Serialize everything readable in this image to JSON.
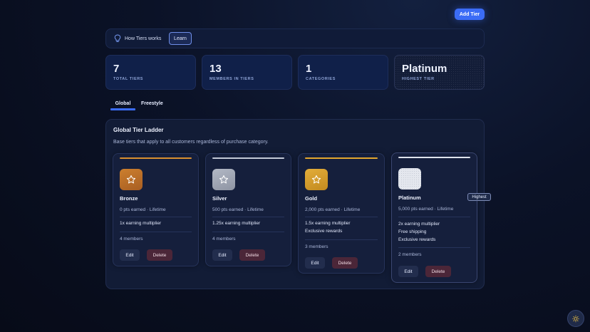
{
  "header": {
    "add_tier_label": "Add Tier"
  },
  "how_bar": {
    "text": "How Tiers works",
    "learn_label": "Learn"
  },
  "stats": [
    {
      "value": "7",
      "label": "TOTAL TIERS"
    },
    {
      "value": "13",
      "label": "MEMBERS IN TIERS"
    },
    {
      "value": "1",
      "label": "CATEGORIES"
    },
    {
      "value": "Platinum",
      "label": "HIGHEST TIER"
    }
  ],
  "tabs": [
    {
      "label": "Global",
      "active": true
    },
    {
      "label": "Freestyle",
      "active": false
    }
  ],
  "panel": {
    "title": "Global Tier Ladder",
    "description": "Base tiers that apply to all customers regardless of purchase category."
  },
  "tiers": [
    {
      "name": "Bronze",
      "points": "0 pts earned · Lifetime",
      "perks": [
        "1x earning multiplier"
      ],
      "members": "4 members",
      "accent": "#d9902f",
      "badge_top": "#cc7f2e",
      "badge_bottom": "#a85e22",
      "edit_label": "Edit",
      "delete_label": "Delete"
    },
    {
      "name": "Silver",
      "points": "500 pts earned · Lifetime",
      "perks": [
        "1.25x earning multiplier"
      ],
      "members": "4 members",
      "accent": "#c3c9d6",
      "badge_top": "#b2b8c5",
      "badge_bottom": "#8e94a3",
      "edit_label": "Edit",
      "delete_label": "Delete"
    },
    {
      "name": "Gold",
      "points": "2,000 pts earned · Lifetime",
      "perks": [
        "1.5x earning multiplier",
        "Exclusive rewards"
      ],
      "members": "3 members",
      "accent": "#e3a72e",
      "badge_top": "#e3ad3a",
      "badge_bottom": "#c28a1f",
      "edit_label": "Edit",
      "delete_label": "Delete"
    },
    {
      "name": "Platinum",
      "badge": "Highest",
      "points": "5,000 pts earned · Lifetime",
      "perks": [
        "2x earning multiplier",
        "Free shipping",
        "Exclusive rewards"
      ],
      "members": "2 members",
      "accent": "#dfe3ec",
      "badge_top": "#e4e7ee",
      "badge_bottom": "#c8ccd6",
      "edit_label": "Edit",
      "delete_label": "Delete"
    }
  ],
  "icons": {
    "bulb": "lightbulb-icon",
    "star": "star-icon",
    "theme": "sun-icon"
  },
  "colors": {
    "accent": "#3b6cf6",
    "delete": "#4b2638"
  }
}
